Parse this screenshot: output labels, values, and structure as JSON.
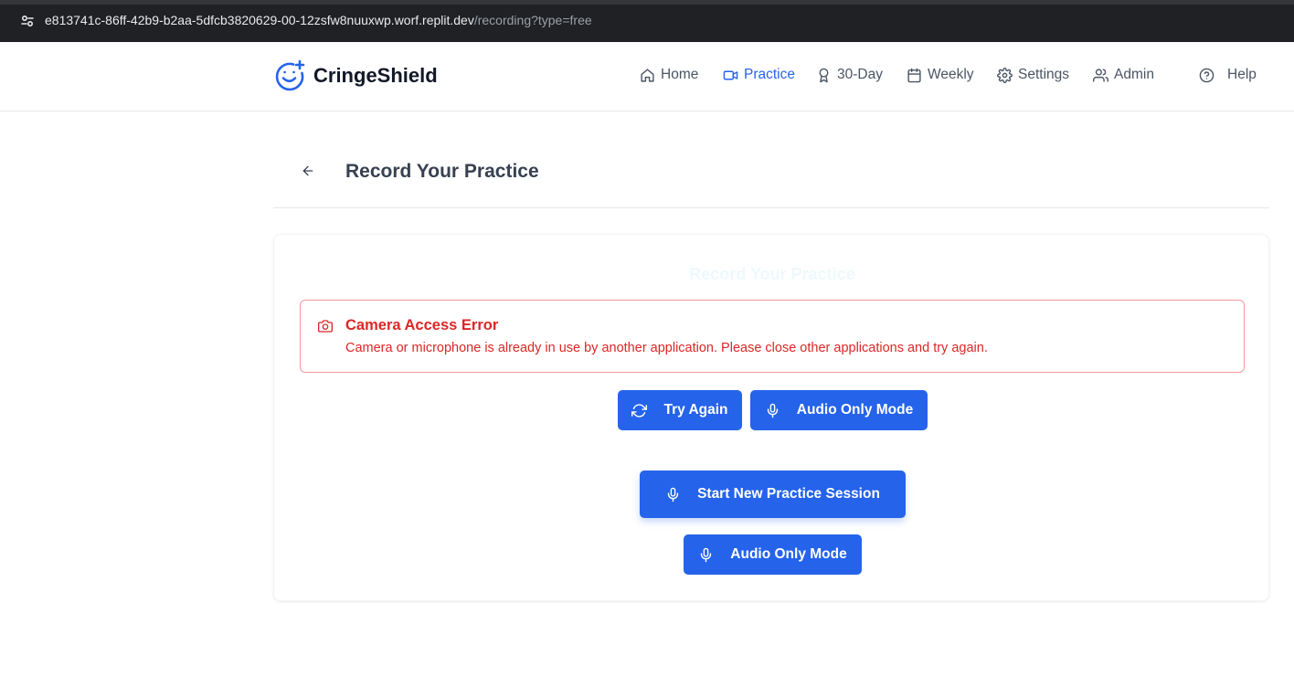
{
  "browser": {
    "url_host": "e813741c-86ff-42b9-b2aa-5dfcb3820629-00-12zsfw8nuuxwp.worf.replit.dev",
    "url_path": "/recording?type=free",
    "site_icon": "tune-icon"
  },
  "brand": {
    "name": "CringeShield",
    "logo_icon": "smile-plus-icon",
    "accent_color": "#2563eb"
  },
  "nav": {
    "items": [
      {
        "label": "Home",
        "icon": "home-icon",
        "active": false
      },
      {
        "label": "Practice",
        "icon": "video-icon",
        "active": true
      },
      {
        "label": "30-Day",
        "icon": "award-icon",
        "active": false
      },
      {
        "label": "Weekly",
        "icon": "calendar-icon",
        "active": false
      },
      {
        "label": "Settings",
        "icon": "gear-icon",
        "active": false
      },
      {
        "label": "Admin",
        "icon": "users-icon",
        "active": false
      },
      {
        "label": "Help",
        "icon": "help-circle-icon",
        "active": false
      }
    ]
  },
  "page": {
    "title": "Record Your Practice",
    "back_icon": "arrow-left-icon"
  },
  "card": {
    "faded_title": "Record Your Practice",
    "error": {
      "title": "Camera Access Error",
      "message": "Camera or microphone is already in use by another application. Please close other applications and try again.",
      "icon": "camera-icon",
      "color": "#dc2626"
    },
    "buttons": {
      "try_again": "Try Again",
      "audio_only_1": "Audio Only Mode",
      "start_session": "Start New Practice Session",
      "audio_only_2": "Audio Only Mode"
    }
  }
}
